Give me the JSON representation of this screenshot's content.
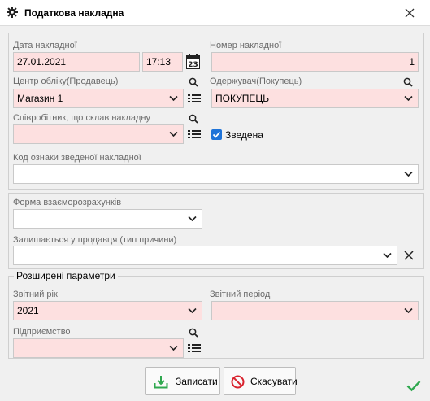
{
  "window": {
    "title": "Податкова накладна",
    "icon": "gear-icon",
    "close_icon": "close-icon"
  },
  "header_group": {
    "date_label": "Дата накладної",
    "date_value": "27.01.2021",
    "time_value": "17:13",
    "calendar_icon_text": "23",
    "number_label": "Номер накладної",
    "number_value": "1",
    "seller_label": "Центр обліку(Продавець)",
    "seller_value": "Магазин 1",
    "buyer_label": "Одержувач(Покупець)",
    "buyer_value": "ПОКУПЕЦЬ",
    "employee_label": "Співробітник, що склав накладну",
    "employee_value": "",
    "consolidated_label": "Зведена",
    "consolidated_checked": true,
    "consolidated_code_label": "Код ознаки зведеної накладної",
    "consolidated_code_value": ""
  },
  "payment_group": {
    "settlement_form_label": "Форма взаєморозрахунків",
    "settlement_form_value": "",
    "seller_remains_label": "Залишається у продавця (тип причини)",
    "seller_remains_value": ""
  },
  "extended_group": {
    "legend": "Розширені параметри",
    "report_year_label": "Звітний рік",
    "report_year_value": "2021",
    "report_period_label": "Звітний період",
    "report_period_value": "",
    "enterprise_label": "Підприємство",
    "enterprise_value": ""
  },
  "buttons": {
    "save_label": "Записати",
    "cancel_label": "Скасувати"
  },
  "colors": {
    "required_bg": "#fde0e0",
    "accent_blue": "#1e73d8",
    "ok_green": "#2fa84f",
    "cancel_red": "#d9232e"
  }
}
